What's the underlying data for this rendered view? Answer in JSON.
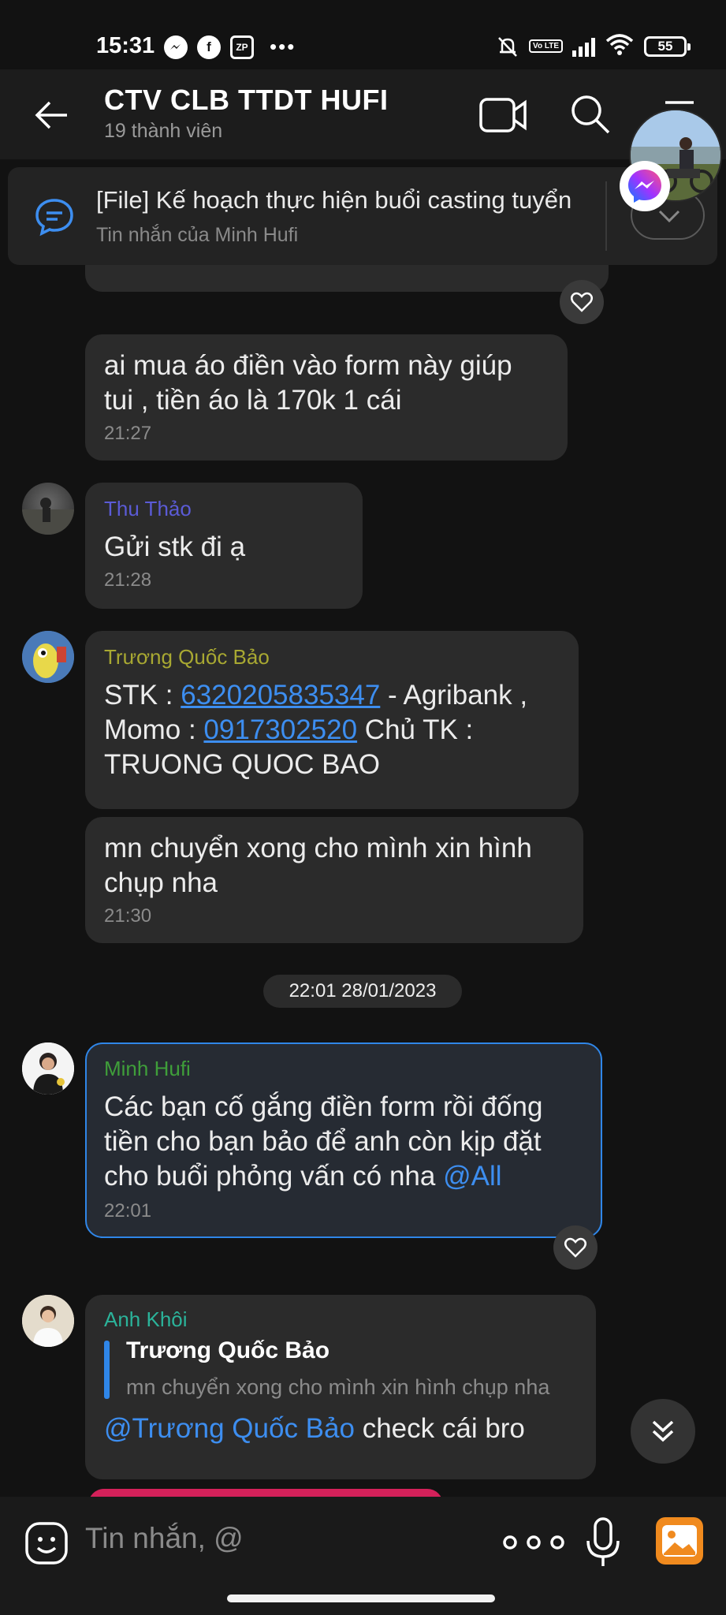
{
  "status_bar": {
    "time": "15:31",
    "notif_icons": [
      "messenger-icon",
      "facebook-icon",
      "zp-icon",
      "more-dots"
    ],
    "zp_label": "ZP",
    "dots": "•••",
    "volte_label": "Vo LTE",
    "battery": "55"
  },
  "header": {
    "title": "CTV CLB TTDT HUFI",
    "subtitle": "19 thành viên"
  },
  "pinned": {
    "title": "[File] Kế hoạch thực hiện buổi casting tuyển",
    "subtitle": "Tin nhắn của Minh Hufi"
  },
  "messages": {
    "m1": {
      "text_line1": "ai mua áo điền vào form này giúp",
      "text_line2": "tui , tiền áo là 170k 1 cái",
      "time": "21:27"
    },
    "m2": {
      "sender": "Thu Thảo",
      "text": "Gửi stk đi ạ",
      "time": "21:28"
    },
    "m3": {
      "sender": "Trương Quốc Bảo",
      "stk_prefix": "STK : ",
      "stk_number": "6320205835347",
      "stk_suffix": " - Agribank ,",
      "momo_prefix": "Momo : ",
      "momo_number": "0917302520",
      "momo_suffix": " Chủ TK :",
      "owner": "TRUONG QUOC BAO"
    },
    "m4": {
      "text_line1": "mn chuyển xong cho mình xin hình",
      "text_line2": "chụp nha",
      "time": "21:30"
    },
    "date_separator": "22:01 28/01/2023",
    "m5": {
      "sender": "Minh Hufi",
      "text_line1": "Các bạn cố gắng điền form rồi đống",
      "text_line2": "tiền cho bạn bảo để anh còn kịp đặt",
      "text_line3": "cho buổi phỏng vấn có nha ",
      "mention": "@All",
      "time": "22:01"
    },
    "m6": {
      "sender": "Anh Khôi",
      "quote_name": "Trương Quốc Bảo",
      "quote_text": "mn chuyển xong cho mình xin hình chụp nha",
      "mention": "@Trương Quốc Bảo",
      "text": " check cái bro"
    }
  },
  "colors": {
    "thu_thao": "#5b5bd6",
    "truong_quoc_bao": "#a8a832",
    "minh_hufi": "#3f9e3a",
    "anh_khoi": "#2bb39a",
    "link": "#3d8ef0"
  },
  "composer": {
    "placeholder": "Tin nhắn, @"
  }
}
